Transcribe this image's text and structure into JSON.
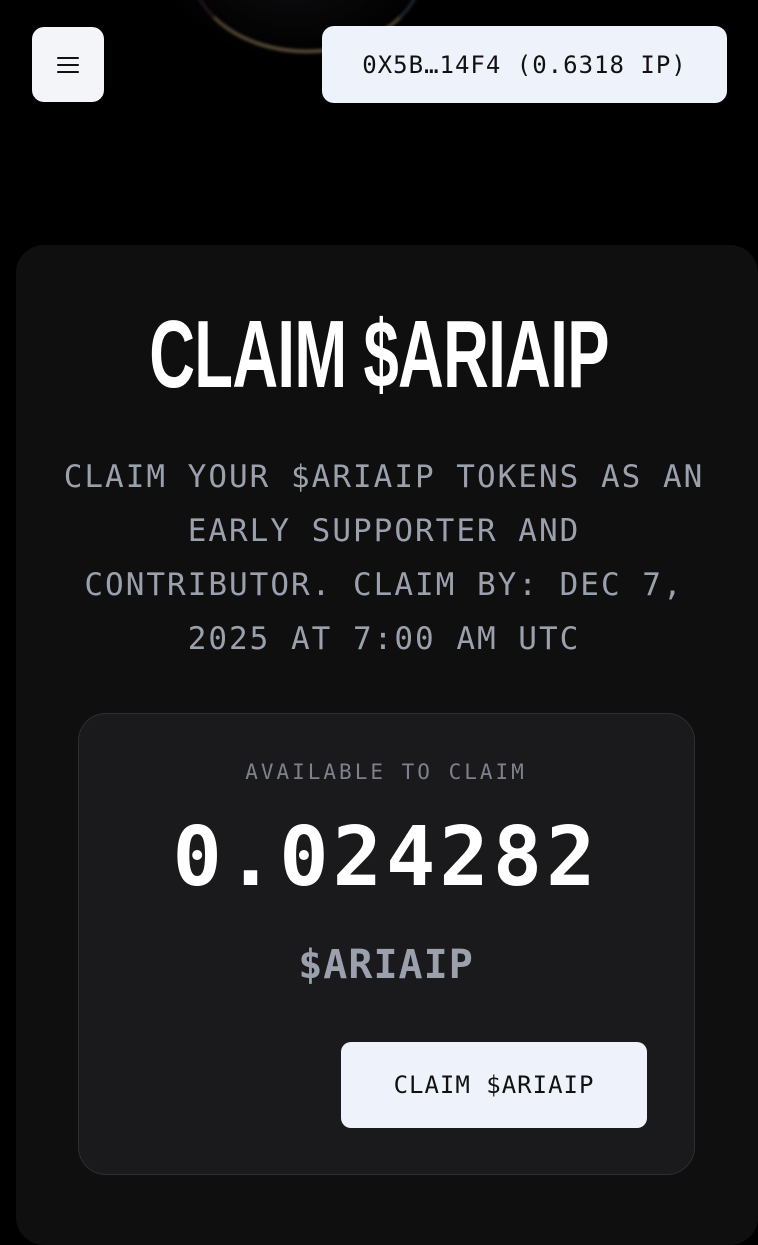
{
  "header": {
    "menu_icon": "hamburger-icon",
    "wallet_label": "0X5B…14F4 (0.6318 IP)"
  },
  "claim_card": {
    "title": "CLAIM $ARIAIP",
    "description": "CLAIM YOUR $ARIAIP TOKENS AS AN EARLY SUPPORTER AND CONTRIBUTOR. CLAIM BY: DEC 7, 2025 AT 7:00 AM UTC",
    "available_label": "AVAILABLE TO CLAIM",
    "amount": "0.024282",
    "token_symbol": "$ARIAIP",
    "claim_button_label": "CLAIM $ARIAIP"
  },
  "colors": {
    "background": "#000000",
    "card": "#0f0f10",
    "claim_box": "#1a1a1c",
    "button": "#eef3fb",
    "muted_text": "#9ba0ad"
  }
}
